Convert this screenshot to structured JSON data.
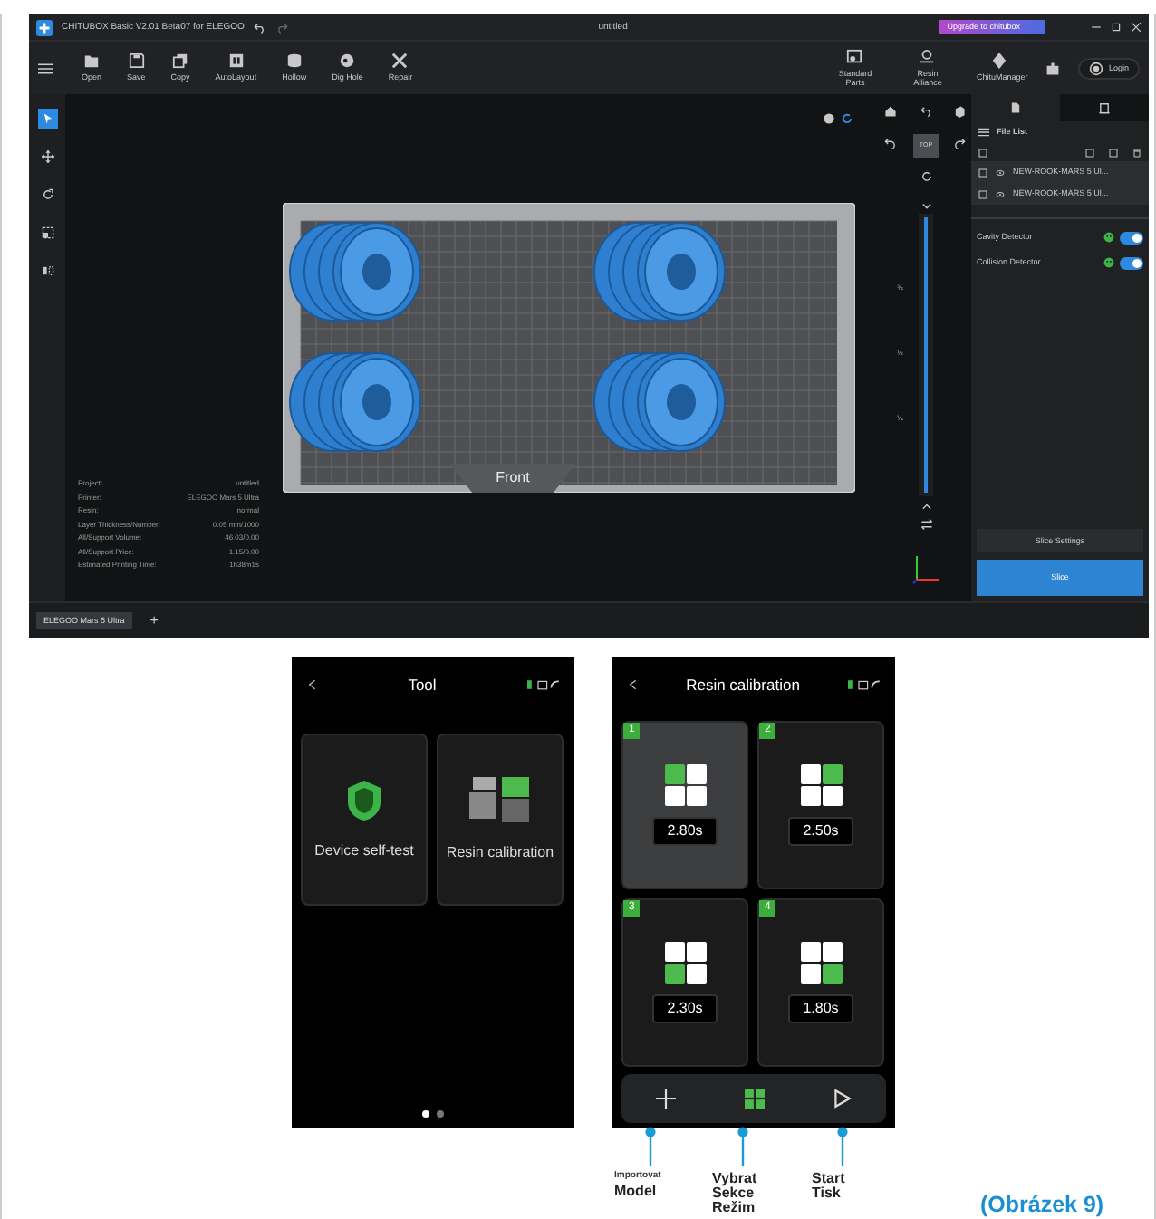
{
  "app": {
    "title": "CHITUBOX Basic V2.01 Beta07 for ELEGOO",
    "document": "untitled",
    "upgrade": "Upgrade to chitubox",
    "toolbar": [
      {
        "label": "Open",
        "kind": "folder"
      },
      {
        "label": "Save",
        "kind": "save"
      },
      {
        "label": "Copy",
        "kind": "copy"
      },
      {
        "label": "AutoLayout",
        "kind": "layout"
      },
      {
        "label": "Hollow",
        "kind": "hollow"
      },
      {
        "label": "Dig Hole",
        "kind": "hole"
      },
      {
        "label": "Repair",
        "kind": "repair"
      }
    ],
    "services": [
      {
        "label": "Standard Parts",
        "kind": "parts"
      },
      {
        "label": "Resin Alliance",
        "kind": "resin"
      },
      {
        "label": "ChituManager",
        "kind": "manager"
      }
    ],
    "login": "Login",
    "tools": [
      {
        "kind": "select",
        "selected": true
      },
      {
        "kind": "move",
        "selected": false
      },
      {
        "kind": "rotate",
        "selected": false
      },
      {
        "kind": "scale",
        "selected": false
      },
      {
        "kind": "mirror",
        "selected": false
      }
    ],
    "top_view": {
      "label": "TOP",
      "selected": true
    },
    "slice_range": {
      "level": 1,
      "marks": [
        "¾",
        "½",
        "¼"
      ]
    },
    "info": [
      {
        "label": "Project:",
        "value": "untitled"
      },
      {
        "label": "Printer:",
        "value": "ELEGOO Mars 5 Ultra"
      },
      {
        "label": "Resin:",
        "value": "normal"
      },
      {
        "label": "Layer Thickness/Number:",
        "value": "0.05 mm/1000"
      },
      {
        "label": "All/Support Volume:",
        "value": "46.03/0.00"
      },
      {
        "label": "All/Support Price:",
        "value": "1.15/0.00"
      },
      {
        "label": "Estimated Printing Time:",
        "value": "1h38m1s"
      }
    ],
    "front_label": "Front",
    "panel_tabs": [
      {
        "kind": "files",
        "selected": true
      },
      {
        "kind": "printer",
        "selected": false
      }
    ],
    "file_list": {
      "title": "File List",
      "files": [
        "NEW-ROOK-MARS 5 Ul...",
        "NEW-ROOK-MARS 5 Ul..."
      ]
    },
    "detectors": [
      {
        "label": "Cavity Detector",
        "on": true
      },
      {
        "label": "Collision Detector",
        "on": true
      }
    ],
    "slice_settings": "Slice Settings",
    "slice": "Slice",
    "printer_tabs": [
      {
        "label": "ELEGOO Mars 5 Ultra",
        "selected": true
      }
    ],
    "add_tab": "+"
  },
  "tool_screen": {
    "title": "Tool",
    "tiles": [
      {
        "label": "Device self-test",
        "kind": "shield"
      },
      {
        "label": "Resin calibration",
        "kind": "cubes"
      }
    ],
    "pages": [
      {
        "selected": true
      },
      {
        "selected": false
      }
    ]
  },
  "calibration_screen": {
    "title": "Resin calibration",
    "cells": [
      {
        "number": "1",
        "time": "2.80s",
        "selected": true
      },
      {
        "number": "2",
        "time": "2.50s",
        "selected": false
      },
      {
        "number": "3",
        "time": "2.30s",
        "selected": false
      },
      {
        "number": "4",
        "time": "1.80s",
        "selected": false
      }
    ],
    "actions": [
      {
        "kind": "add",
        "note": "Importovat",
        "label": "Model"
      },
      {
        "kind": "grid",
        "label": "Vybrat Sekce Režim"
      },
      {
        "kind": "play",
        "label": "Start Tisk"
      }
    ]
  },
  "caption": "(Obrázek 9)"
}
